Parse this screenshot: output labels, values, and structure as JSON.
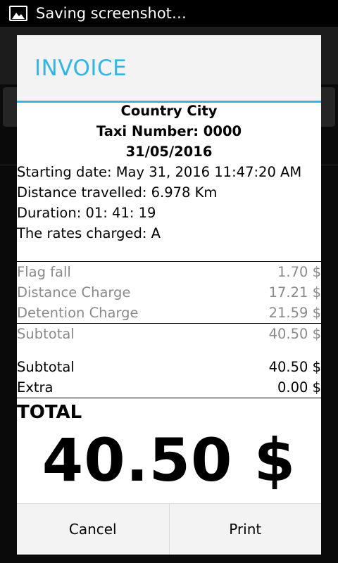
{
  "status_bar": {
    "text": "Saving screenshot…",
    "icon": "image-icon"
  },
  "dialog": {
    "title": "INVOICE",
    "header_lines": [
      "Country City",
      "Taxi Number: 0000",
      "31/05/2016"
    ],
    "info_lines": [
      "Starting date: May 31, 2016 11:47:20 AM",
      "Distance travelled: 6.978 Km",
      "Duration: 01: 41: 19",
      "The rates charged: A"
    ],
    "charges": [
      {
        "label": "Flag fall",
        "value": "1.70 $"
      },
      {
        "label": "Distance Charge",
        "value": "17.21 $"
      },
      {
        "label": "Detention Charge",
        "value": "21.59 $"
      }
    ],
    "subtotal_gray": {
      "label": "Subtotal",
      "value": "40.50 $"
    },
    "subtotal": {
      "label": "Subtotal",
      "value": "40.50 $"
    },
    "extra": {
      "label": "Extra",
      "value": "0.00 $"
    },
    "total_label": "TOTAL",
    "total_amount": "40.50 $",
    "buttons": {
      "cancel": "Cancel",
      "print": "Print"
    }
  },
  "colors": {
    "accent": "#33b5e5",
    "muted": "#8a8a8a"
  }
}
